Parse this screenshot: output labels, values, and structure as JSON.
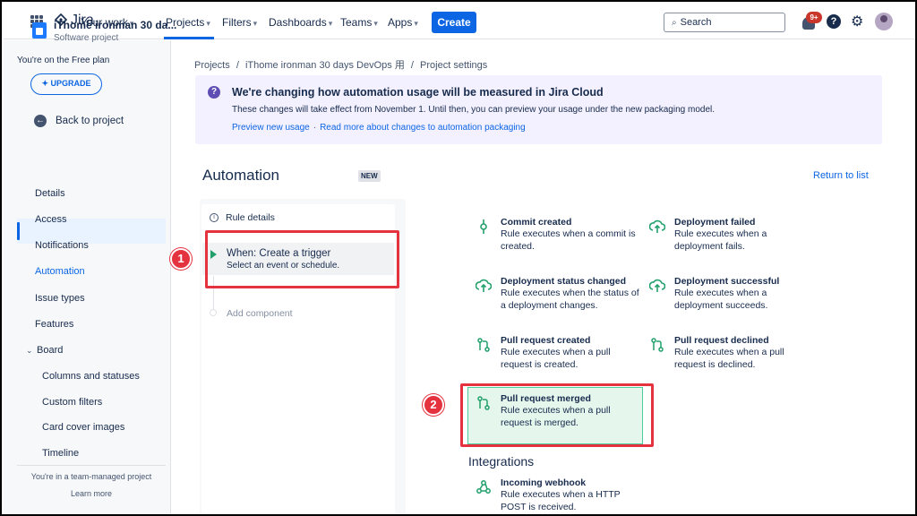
{
  "topnav": {
    "logo_text": "Jira",
    "items": [
      {
        "label": "Your work"
      },
      {
        "label": "Projects"
      },
      {
        "label": "Filters"
      },
      {
        "label": "Dashboards"
      },
      {
        "label": "Teams"
      },
      {
        "label": "Apps"
      }
    ],
    "create_label": "Create",
    "search_placeholder": "Search",
    "notification_badge": "9+",
    "help_glyph": "?",
    "icons": [
      "app-switcher-icon",
      "jira-logo-icon",
      "bell-icon",
      "help-icon",
      "gear-icon",
      "avatar"
    ]
  },
  "sidebar": {
    "project_name": "iThome ironman 30 da...",
    "project_type": "Software project",
    "plan_text": "You're on the Free plan",
    "upgrade_label": "✦ UPGRADE",
    "back_label": "Back to project",
    "items": [
      {
        "label": "Details"
      },
      {
        "label": "Access"
      },
      {
        "label": "Notifications"
      },
      {
        "label": "Automation",
        "active": true
      },
      {
        "label": "Issue types"
      },
      {
        "label": "Features"
      },
      {
        "label": "Board"
      },
      {
        "label": "Columns and statuses"
      },
      {
        "label": "Custom filters"
      },
      {
        "label": "Card cover images"
      },
      {
        "label": "Timeline"
      }
    ],
    "team_managed_text": "You're in a team-managed project",
    "learn_more": "Learn more"
  },
  "breadcrumb": {
    "items": [
      "Projects",
      "iThome ironman 30 days DevOps 用",
      "Project settings"
    ],
    "separator": "/"
  },
  "banner": {
    "title": "We're changing how automation usage will be measured in Jira Cloud",
    "text": "These changes will take effect from November 1. Until then, you can preview your usage under the new packaging model.",
    "link1": "Preview new usage",
    "link_sep": "·",
    "link2": "Read more about changes to automation packaging"
  },
  "automation": {
    "title": "Automation",
    "new_badge": "NEW",
    "return_link": "Return to list"
  },
  "rule": {
    "details_label": "Rule details",
    "trigger_title": "When: Create a trigger",
    "trigger_sub": "Select an event or schedule.",
    "add_component": "Add component"
  },
  "markers": [
    "1",
    "2"
  ],
  "triggers": [
    {
      "name": "Commit created",
      "desc": "Rule executes when a commit is created.",
      "icon": "commit-icon"
    },
    {
      "name": "Deployment failed",
      "desc": "Rule executes when a deployment fails.",
      "icon": "cloud-upload-icon"
    },
    {
      "name": "Deployment status changed",
      "desc": "Rule executes when the status of a deployment changes.",
      "icon": "cloud-upload-icon"
    },
    {
      "name": "Deployment successful",
      "desc": "Rule executes when a deployment succeeds.",
      "icon": "cloud-upload-icon"
    },
    {
      "name": "Pull request created",
      "desc": "Rule executes when a pull request is created.",
      "icon": "pull-request-icon"
    },
    {
      "name": "Pull request declined",
      "desc": "Rule executes when a pull request is declined.",
      "icon": "pull-request-icon"
    },
    {
      "name": "Pull request merged",
      "desc": "Rule executes when a pull request is merged.",
      "icon": "pull-request-icon",
      "selected": true
    }
  ],
  "integrations": {
    "title": "Integrations",
    "items": [
      {
        "name": "Incoming webhook",
        "desc": "Rule executes when a HTTP POST is received.",
        "icon": "webhook-icon"
      }
    ]
  },
  "colors": {
    "accent": "#0c66e4",
    "trigger_green": "#22a06b",
    "annotation_red": "#e5323f",
    "banner_bg": "#f3f0ff"
  }
}
